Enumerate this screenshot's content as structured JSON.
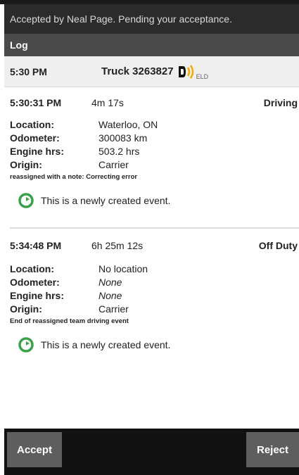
{
  "banner": {
    "text": "Accepted by Neal Page. Pending your acceptance."
  },
  "log_bar": {
    "title": "Log"
  },
  "vehicle_row": {
    "time": "5:30 PM",
    "truck": "Truck 3263827",
    "eld_label": "ELD",
    "eld_color": "#f2a900"
  },
  "labels": {
    "location": "Location:",
    "odometer": "Odometer:",
    "engine_hrs": "Engine hrs:",
    "origin": "Origin:"
  },
  "events": [
    {
      "time": "5:30:31 PM",
      "duration": "4m 17s",
      "status": "Driving",
      "location": "Waterloo, ON",
      "odometer": "300083 km",
      "engine_hrs": "503.2 hrs",
      "origin": "Carrier",
      "note": "reassigned with a note: Correcting error",
      "created_text": "This is a newly created event.",
      "created_icon": "green-refresh-icon"
    },
    {
      "time": "5:34:48 PM",
      "duration": "6h 25m 12s",
      "status": "Off Duty",
      "location": "No location",
      "odometer": "None",
      "engine_hrs": "None",
      "origin": "Carrier",
      "note": "End of reassigned team driving event",
      "created_text": "This is a newly created event.",
      "created_icon": "green-refresh-icon"
    }
  ],
  "footer": {
    "accept_label": "Accept",
    "reject_label": "Reject"
  },
  "colors": {
    "accent_green": "#3aa14a",
    "footer_bg": "#111111",
    "button_bg": "#5e5e5e"
  }
}
